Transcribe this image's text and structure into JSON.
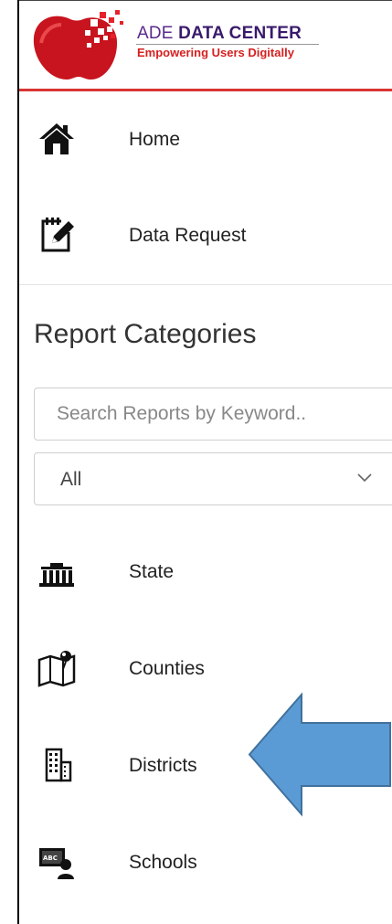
{
  "header": {
    "logo_title_prefix": "ADE",
    "logo_title_bold": "DATA CENTER",
    "logo_subtitle": "Empowering Users Digitally"
  },
  "nav": {
    "home": "Home",
    "data_request": "Data Request"
  },
  "report_categories": {
    "title": "Report Categories",
    "search_placeholder": "Search Reports by Keyword..",
    "filter_selected": "All",
    "items": [
      {
        "label": "State",
        "icon": "state-building-icon"
      },
      {
        "label": "Counties",
        "icon": "map-pin-icon"
      },
      {
        "label": "Districts",
        "icon": "office-building-icon"
      },
      {
        "label": "Schools",
        "icon": "classroom-teacher-icon"
      }
    ]
  },
  "colors": {
    "header_rule": "#d93434",
    "brand_red": "#d62020",
    "brand_purple": "#5a2a8a",
    "arrow_fill": "#5b9bd5",
    "arrow_stroke": "#41719c"
  }
}
